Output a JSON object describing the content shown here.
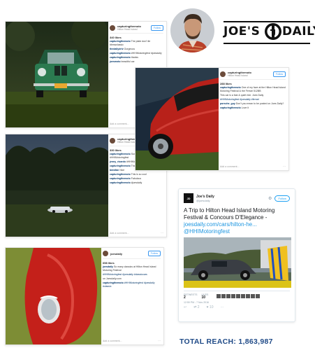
{
  "brand": {
    "logo_left": "JOE'S",
    "logo_right": "DAILY"
  },
  "posts": [
    {
      "username": "capturingthemoto",
      "location": "Hilton Head Island",
      "follow_label": "Follow",
      "likes": "340 likes",
      "lines": [
        {
          "user": "capturingthemoto",
          "text": "The plate don't lie #bmwclassic"
        },
        {
          "user": "thedailydriv",
          "text": "Gorgeous"
        },
        {
          "user": "capturingthemoto",
          "text": "#HHIMotoringfest #joesdaily"
        },
        {
          "user": "capturingthemoto",
          "text": "thanks"
        },
        {
          "user": "joesmoto",
          "text": "beautiful car"
        }
      ],
      "comment_placeholder": "Add a comment..."
    },
    {
      "username": "capturingthemoto",
      "location": "Hilton Head Island",
      "follow_label": "Follow",
      "likes": "288 likes",
      "lines": [
        {
          "user": "capturingthemoto",
          "text": "One of my fave at the Hilton Head Island Motoring Festival & the Ferrari 512BB"
        },
        {
          "user": "",
          "text": "This car is a fast & quiet ride. Joes Daily"
        },
        {
          "user": "",
          "text": "#HHIMotoringfest #joesdaily #ferrari"
        },
        {
          "user": "porsche_guy",
          "text": "Don't you mean to be posted on Joes Daily?"
        },
        {
          "user": "capturingthemoto",
          "text": "Love it"
        }
      ],
      "comment_placeholder": "Add a comment..."
    },
    {
      "username": "capturingthemoto",
      "location": "Hilton Head Island",
      "follow_label": "Follow",
      "likes": "330 likes",
      "lines": [
        {
          "user": "capturingthemoto",
          "text": "Sunset on the field #HHIMotoringfest"
        },
        {
          "user": "jenny_ricardo",
          "text": "#HHIMotoringfest"
        },
        {
          "user": "capturingthemoto",
          "text": "Thanks"
        },
        {
          "user": "bmwfan",
          "text": "Nice"
        },
        {
          "user": "capturingthemoto",
          "text": "This is so cool"
        },
        {
          "user": "capturingthemoto",
          "text": "Fabulous"
        },
        {
          "user": "capturingthemoto",
          "text": "#joesdaily"
        }
      ],
      "comment_placeholder": "Add a comment..."
    },
    {
      "username": "joesdaily",
      "location": "",
      "follow_label": "Follow",
      "likes": "658 likes",
      "lines": [
        {
          "user": "joesdaily",
          "text": "So many classics at Hilton Head Island Motoring Festival"
        },
        {
          "user": "",
          "text": "#HHIMotoringfest #joesdaily #classiccars"
        },
        {
          "user": "",
          "text": "on Joesdaily.com"
        },
        {
          "user": "capturingthemoto",
          "text": "#HHIMotoringfest #joesdaily #classic"
        }
      ],
      "comment_placeholder": "Add a comment..."
    }
  ],
  "tweet": {
    "avatar_text": "JD",
    "name": "Joe's Daily",
    "handle": "@joesdaily",
    "follow_label": "Follow",
    "text_main": "A Trip to Hilton Head Island Motoring Festival & Concours D'Elegance -",
    "link": "joesdaily.com/cars/hilton-he...",
    "mention": "@HHIMotoringfest",
    "retweets_label": "RETWEETS",
    "retweets": "2",
    "likes_label": "LIKES",
    "likes": "10",
    "timestamp": "12:59 PM - 7 Nov 2016",
    "actions": [
      "↩",
      "⇄ 2",
      "♥ 10",
      "···"
    ]
  },
  "total_reach": "TOTAL REACH: 1,863,987",
  "colors": {
    "link_blue": "#1b95e0",
    "reach_blue": "#1f4a87",
    "instagram_blue": "#3897f0"
  }
}
